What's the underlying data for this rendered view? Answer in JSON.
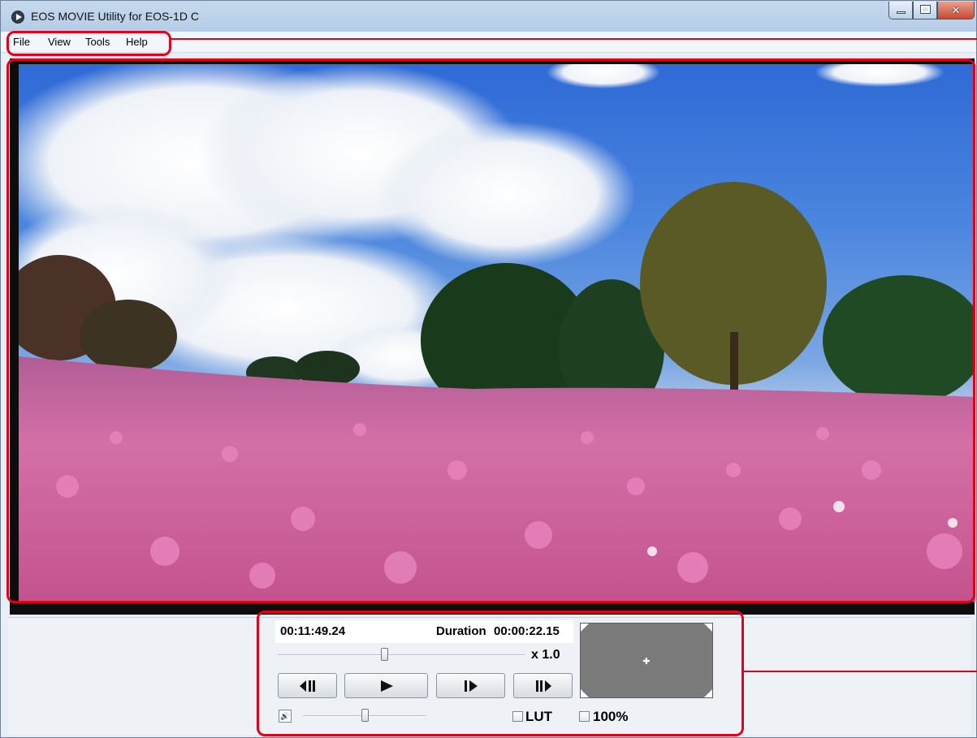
{
  "window": {
    "title": "EOS MOVIE Utility for EOS-1D C"
  },
  "menu": {
    "items": [
      "File",
      "View",
      "Tools",
      "Help"
    ]
  },
  "playback": {
    "timecode": "00:11:49.24",
    "duration_label": "Duration",
    "duration_value": "00:00:22.15",
    "speed": "x 1.0",
    "position_fraction": 0.43,
    "volume_fraction": 0.5
  },
  "options": {
    "lut_label": "LUT",
    "zoom_label": "100%",
    "lut_checked": false,
    "zoom_checked": false
  },
  "icons": {
    "app": "play-circle-icon",
    "step_back": "step-back-icon",
    "play": "play-icon",
    "step_forward": "step-forward-icon",
    "frame_forward": "frame-forward-icon",
    "volume": "speaker-icon",
    "navigator": "crosshair-icon"
  },
  "colors": {
    "callout": "#e3001b",
    "navigator_bg": "#7a7a7a"
  }
}
